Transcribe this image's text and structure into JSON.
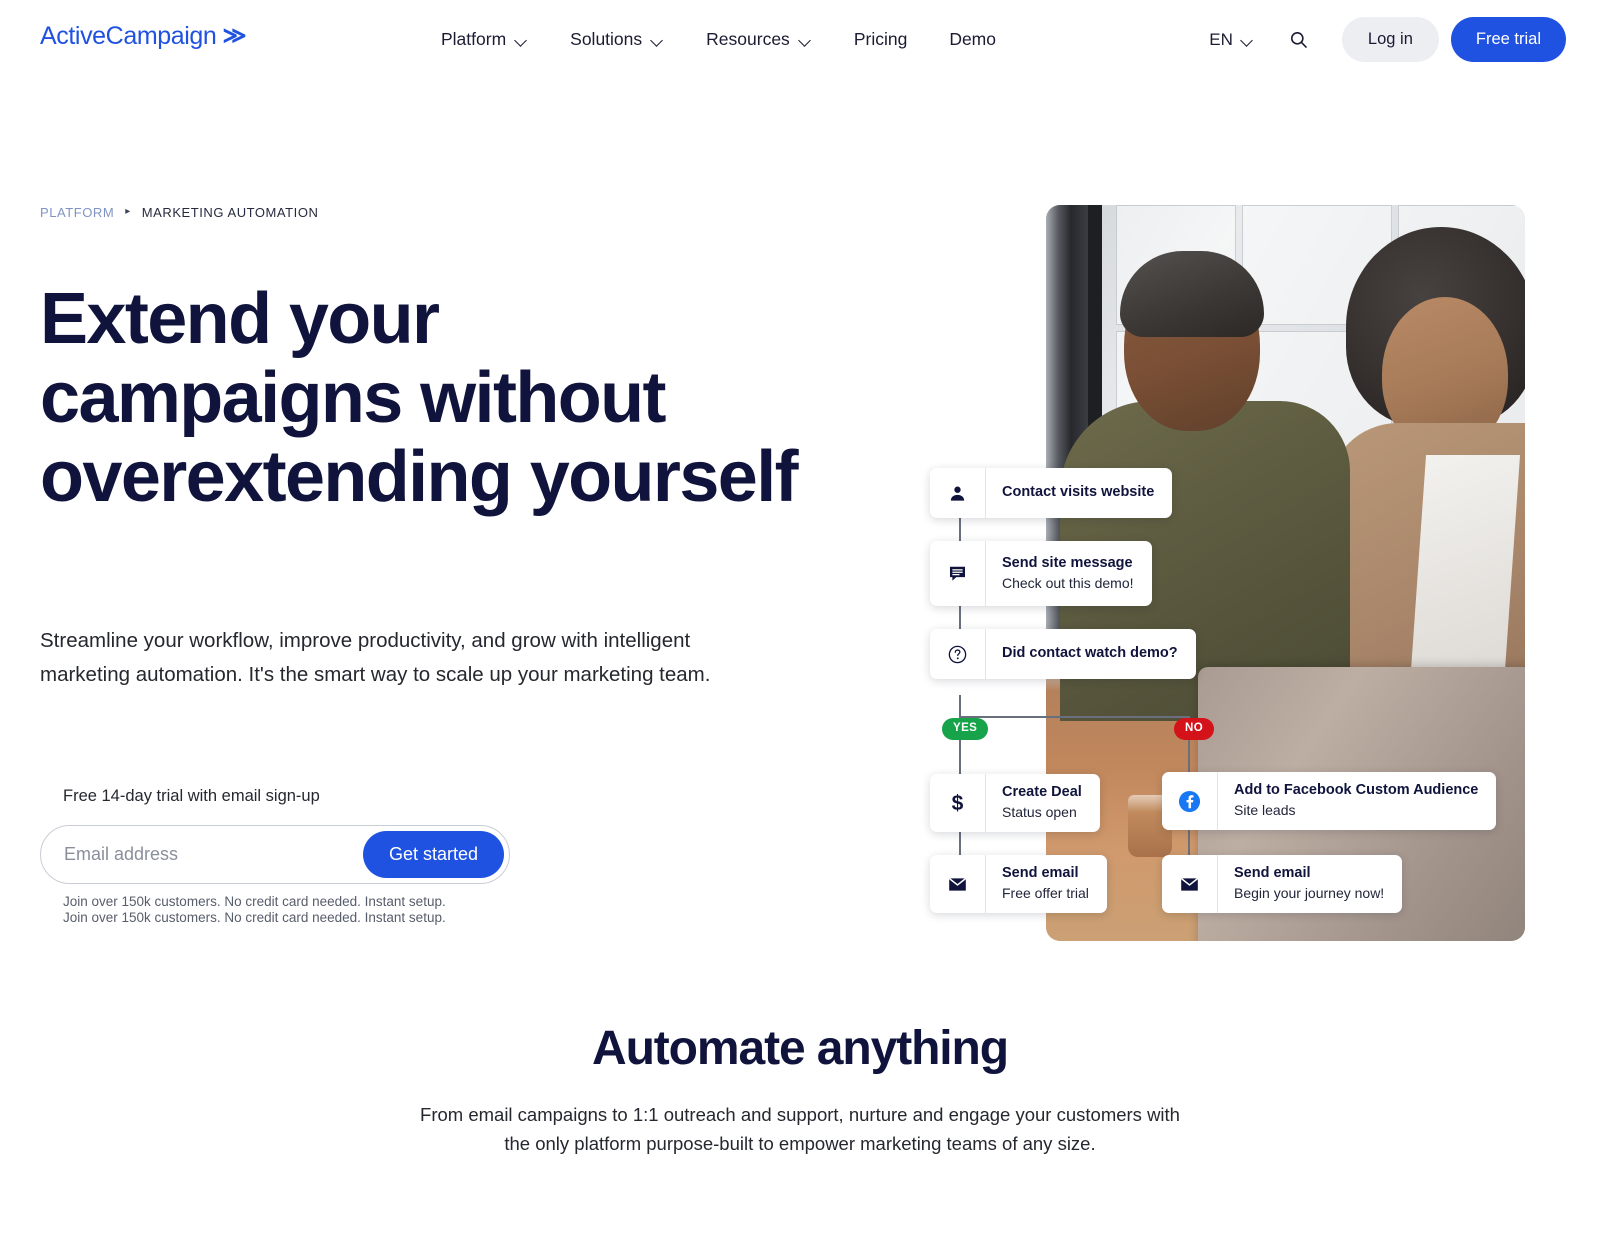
{
  "header": {
    "logo_text": "ActiveCampaign",
    "logo_chevron": "≫",
    "nav": [
      {
        "label": "Platform",
        "has_caret": true
      },
      {
        "label": "Solutions",
        "has_caret": true
      },
      {
        "label": "Resources",
        "has_caret": true
      },
      {
        "label": "Pricing",
        "has_caret": false
      },
      {
        "label": "Demo",
        "has_caret": false
      }
    ],
    "language": "EN",
    "login_label": "Log in",
    "trial_label": "Free trial"
  },
  "hero": {
    "breadcrumb": {
      "parent": "PLATFORM",
      "separator": "▸",
      "current": "MARKETING AUTOMATION"
    },
    "title": "Extend your campaigns without overextending yourself",
    "subtitle": "Streamline your workflow, improve productivity, and grow with intelligent marketing automation. It's the smart way to scale up your marketing team.",
    "signup": {
      "label": "Free 14-day trial with email sign-up",
      "placeholder": "Email address",
      "value": "",
      "button": "Get started",
      "note_1": "Join over 150k customers. No credit card needed. Instant setup.",
      "note_2": "Join over 150k customers. No credit card needed. Instant setup."
    }
  },
  "flow": {
    "nodes": [
      {
        "icon": "person-icon",
        "title": "Contact visits website",
        "sub": ""
      },
      {
        "icon": "message-icon",
        "title": "Send site message",
        "sub": "Check out this demo!"
      },
      {
        "icon": "question-icon",
        "title": "Did contact watch demo?",
        "sub": ""
      },
      {
        "icon": "dollar-icon",
        "title": "Create Deal",
        "sub": "Status open"
      },
      {
        "icon": "facebook-icon",
        "title": "Add to Facebook Custom Audience",
        "sub": "Site leads"
      },
      {
        "icon": "envelope-icon",
        "title": "Send email",
        "sub": "Free offer trial"
      },
      {
        "icon": "envelope-icon",
        "title": "Send email",
        "sub": "Begin your journey now!"
      }
    ],
    "badge_yes": "YES",
    "badge_no": "NO"
  },
  "section": {
    "title": "Automate anything",
    "subtitle": "From email campaigns to 1:1 outreach and support, nurture and engage your customers with the only platform purpose-built to empower marketing teams of any size."
  },
  "colors": {
    "brand_blue": "#1f52e0",
    "headline_navy": "#10143c",
    "yes_green": "#16a34a",
    "no_red": "#d3121a",
    "login_grey": "#eceef2"
  }
}
